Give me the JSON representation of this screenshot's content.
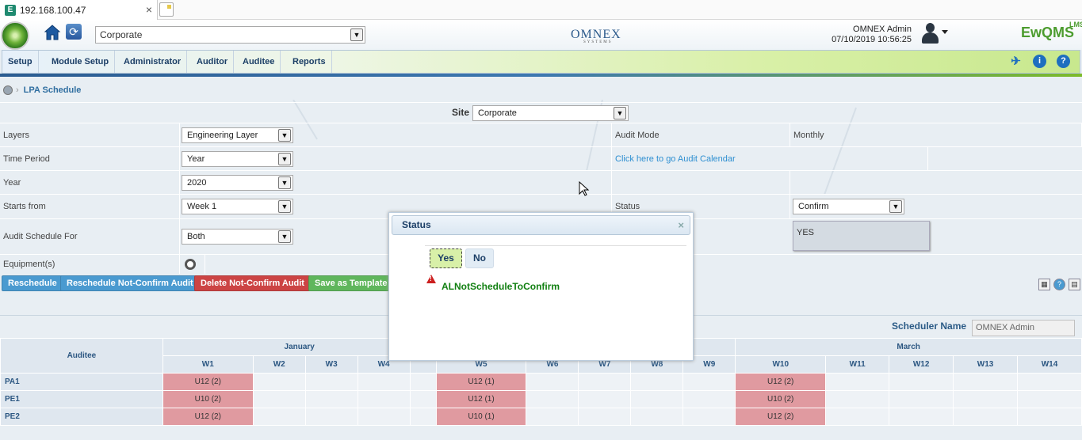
{
  "browser": {
    "tab_title": "192.168.100.47",
    "close_glyph": "×"
  },
  "header": {
    "site_select_value": "Corporate",
    "company_logo": "OMNEX",
    "company_logo_sub": "SYSTEMS",
    "user_name": "OMNEX Admin",
    "datetime": "07/10/2019 10:56:25",
    "product_logo": "EwQMS",
    "product_logo_sub": "LMS"
  },
  "menu": {
    "items": [
      "Setup",
      "Module Setup",
      "Administrator",
      "Auditor",
      "Auditee",
      "Reports"
    ],
    "tools": {
      "pin": "pin-icon",
      "info": "i",
      "help": "?"
    }
  },
  "breadcrumb": {
    "label": "LPA Schedule",
    "separator": "›"
  },
  "form": {
    "site_label": "Site",
    "site_value": "Corporate",
    "layers_label": "Layers",
    "layers_value": "Engineering Layer",
    "audit_mode_label": "Audit Mode",
    "audit_mode_value": "Monthly",
    "time_period_label": "Time Period",
    "time_period_value": "Year",
    "calendar_link": "Click here to go Audit Calendar",
    "year_label": "Year",
    "year_value": "2020",
    "starts_from_label": "Starts from",
    "starts_from_value": "Week 1",
    "status_label": "Status",
    "status_value": "Confirm",
    "schedule_for_label": "Audit Schedule For",
    "schedule_for_value": "Both",
    "yes_box_value": "YES",
    "equipment_label": "Equipment(s)"
  },
  "buttons": {
    "reschedule": "Reschedule",
    "reschedule_not_confirm": "Reschedule Not-Confirm Audit",
    "delete_not_confirm": "Delete Not-Confirm Audit",
    "save_template": "Save as Template"
  },
  "scheduler": {
    "name_label": "Scheduler Name",
    "name_value": "OMNEX Admin",
    "auditee_header": "Auditee",
    "months": [
      {
        "name": "January",
        "span": 5
      },
      {
        "name": "",
        "span": 4
      },
      {
        "name": "March",
        "span": 5
      }
    ],
    "weeks": [
      "W1",
      "W2",
      "W3",
      "W4",
      "",
      "W5",
      "W6",
      "W7",
      "W8",
      "W9",
      "W10",
      "W11",
      "W12",
      "W13",
      "W14"
    ],
    "rows": [
      {
        "auditee": "PA1",
        "cells": [
          "U12 (2)",
          "",
          "",
          "",
          "",
          "U12 (1)",
          "",
          "",
          "",
          "",
          "U12 (2)",
          "",
          "",
          "",
          ""
        ]
      },
      {
        "auditee": "PE1",
        "cells": [
          "U10 (2)",
          "",
          "",
          "",
          "",
          "U12 (1)",
          "",
          "",
          "",
          "",
          "U10 (2)",
          "",
          "",
          "",
          ""
        ]
      },
      {
        "auditee": "PE2",
        "cells": [
          "U12 (2)",
          "",
          "",
          "",
          "",
          "U10 (1)",
          "",
          "",
          "",
          "",
          "U12 (2)",
          "",
          "",
          "",
          ""
        ]
      }
    ]
  },
  "modal": {
    "title": "Status",
    "close_glyph": "×",
    "yes_label": "Yes",
    "no_label": "No",
    "message": "ALNotScheduleToConfirm"
  }
}
